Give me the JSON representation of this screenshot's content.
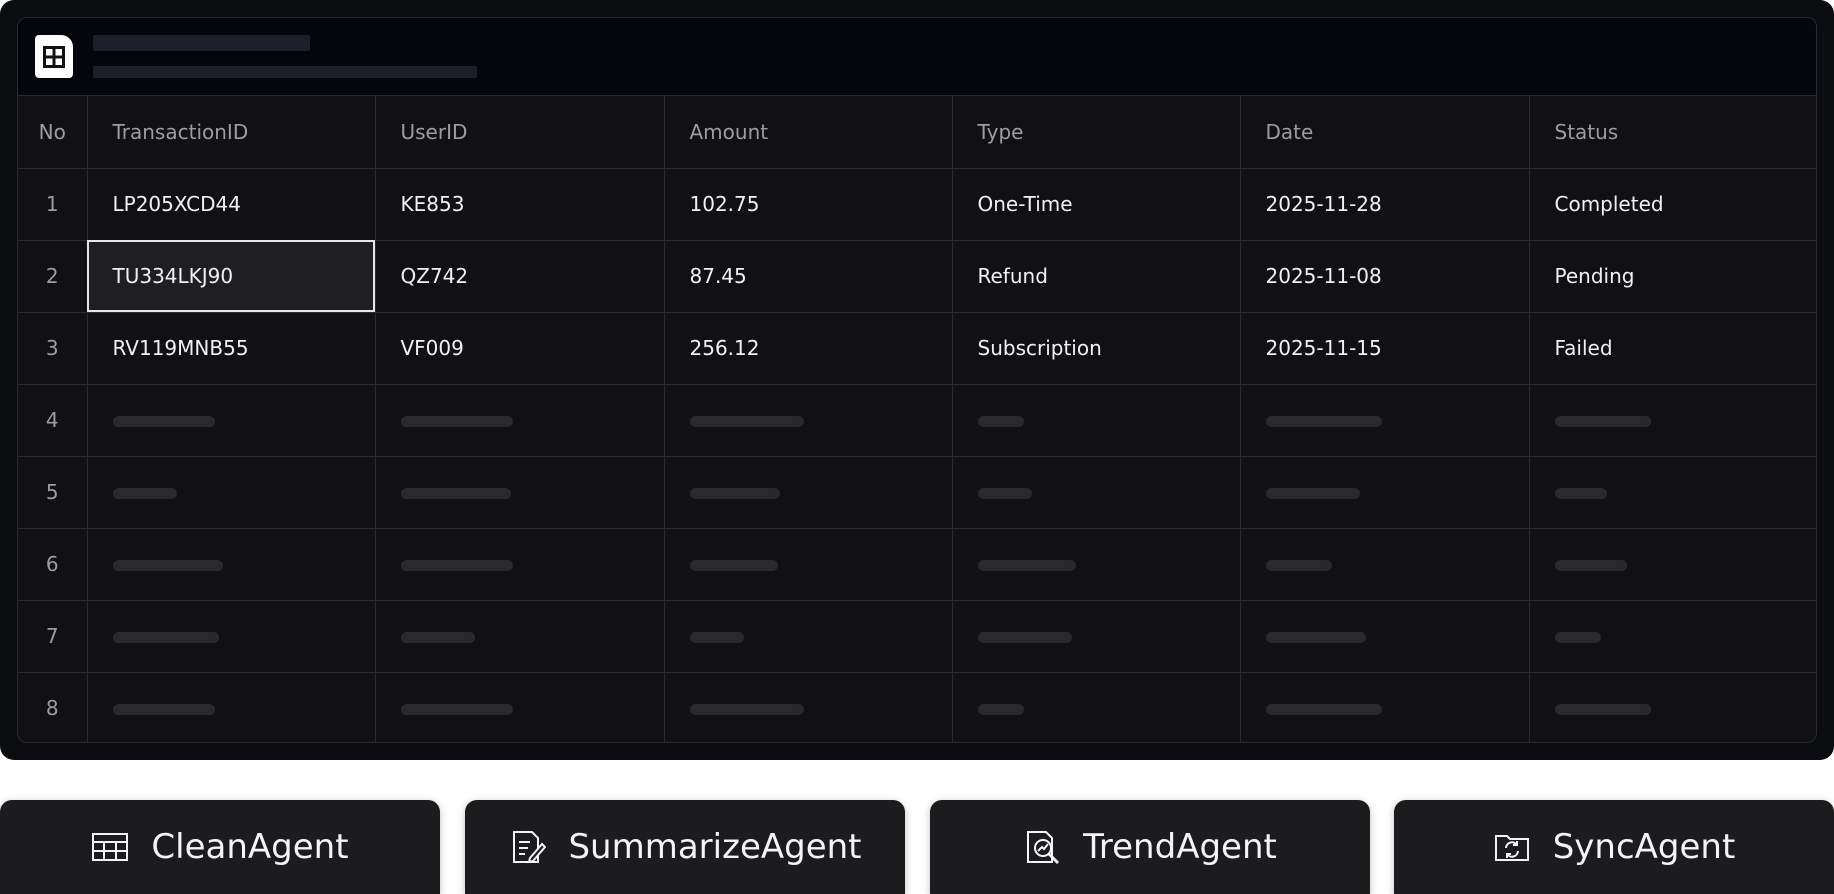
{
  "table": {
    "columns": [
      "No",
      "TransactionID",
      "UserID",
      "Amount",
      "Type",
      "Date",
      "Status"
    ],
    "rows": [
      {
        "no": "1",
        "transaction_id": "LP205XCD44",
        "user_id": "KE853",
        "amount": "102.75",
        "type": "One-Time",
        "date": "2025-11-28",
        "status": "Completed"
      },
      {
        "no": "2",
        "transaction_id": "TU334LKJ90",
        "user_id": "QZ742",
        "amount": "87.45",
        "type": "Refund",
        "date": "2025-11-08",
        "status": "Pending"
      },
      {
        "no": "3",
        "transaction_id": "RV119MNB55",
        "user_id": "VF009",
        "amount": "256.12",
        "type": "Subscription",
        "date": "2025-11-15",
        "status": "Failed"
      }
    ],
    "placeholder_row_numbers": [
      "4",
      "5",
      "6",
      "7",
      "8"
    ]
  },
  "agents": [
    {
      "label": "CleanAgent",
      "icon": "table-icon"
    },
    {
      "label": "SummarizeAgent",
      "icon": "document-edit-icon"
    },
    {
      "label": "TrendAgent",
      "icon": "chart-search-icon"
    },
    {
      "label": "SyncAgent",
      "icon": "folder-sync-icon"
    }
  ],
  "colors": {
    "background": "#0b0c10",
    "cell_text": "#f1f1f3",
    "header_text": "#9c9ca4",
    "button_bg": "#1c1c1e"
  }
}
